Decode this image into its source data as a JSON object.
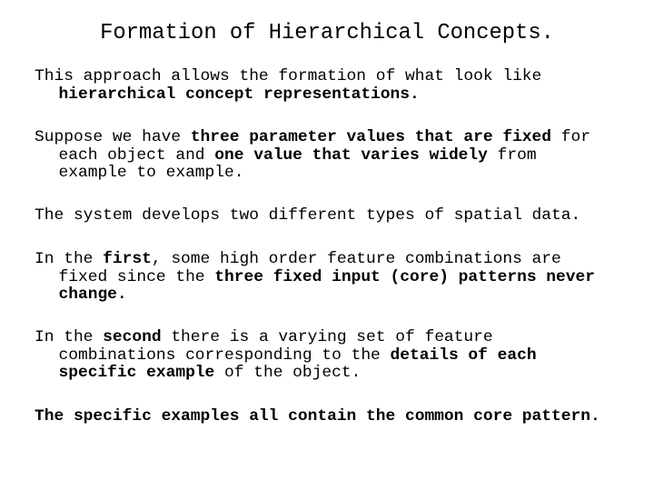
{
  "slide": {
    "title": "Formation of Hierarchical Concepts.",
    "paragraphs": [
      {
        "lines": [
          [
            {
              "t": "This approach allows the formation of what look like",
              "b": false
            }
          ],
          [
            {
              "t": "hierarchical concept representations.",
              "b": true
            }
          ]
        ]
      },
      {
        "lines": [
          [
            {
              "t": "Suppose we have ",
              "b": false
            },
            {
              "t": "three parameter values that are fixed",
              "b": true
            },
            {
              "t": " for",
              "b": false
            }
          ],
          [
            {
              "t": "each object and ",
              "b": false
            },
            {
              "t": "one value that varies widely",
              "b": true
            },
            {
              "t": " from",
              "b": false
            }
          ],
          [
            {
              "t": "example to example.",
              "b": false
            }
          ]
        ]
      },
      {
        "lines": [
          [
            {
              "t": "The system develops two different types of spatial data.",
              "b": false
            }
          ]
        ]
      },
      {
        "lines": [
          [
            {
              "t": "In the ",
              "b": false
            },
            {
              "t": "first",
              "b": true
            },
            {
              "t": ", some high order feature combinations are",
              "b": false
            }
          ],
          [
            {
              "t": "fixed since the ",
              "b": false
            },
            {
              "t": "three fixed input (core) patterns never",
              "b": true
            }
          ],
          [
            {
              "t": "change.",
              "b": true
            }
          ]
        ]
      },
      {
        "lines": [
          [
            {
              "t": "In the ",
              "b": false
            },
            {
              "t": "second",
              "b": true
            },
            {
              "t": " there is a varying set of feature",
              "b": false
            }
          ],
          [
            {
              "t": "combinations corresponding to the ",
              "b": false
            },
            {
              "t": "details of each",
              "b": true
            }
          ],
          [
            {
              "t": "specific example",
              "b": true
            },
            {
              "t": " of the object.",
              "b": false
            }
          ]
        ]
      },
      {
        "lines": [
          [
            {
              "t": "The specific examples all contain the common core pattern.",
              "b": true
            }
          ]
        ]
      }
    ]
  }
}
